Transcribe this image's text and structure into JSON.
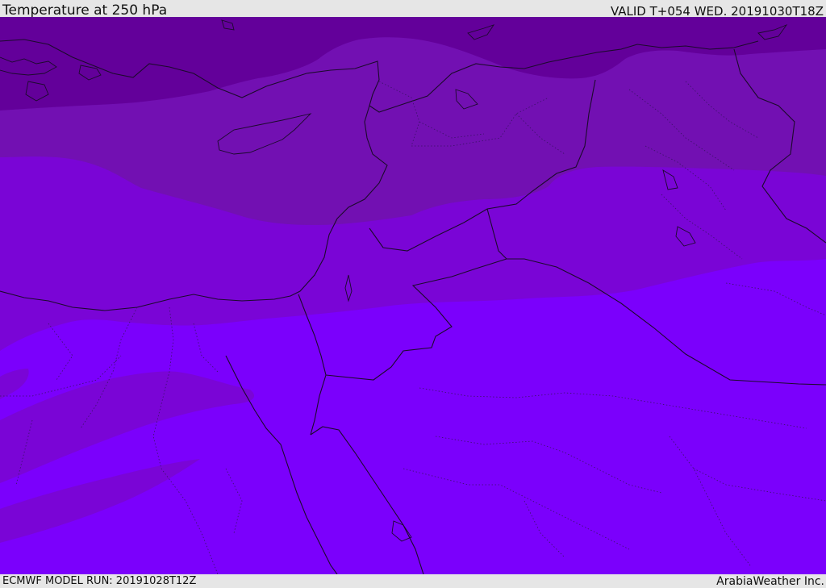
{
  "header": {
    "title": "Temperature at 250 hPa",
    "valid": "VALID T+054 WED. 20191030T18Z"
  },
  "footer": {
    "model_run": "ECMWF MODEL RUN: 20191028T12Z",
    "credit": "ArabiaWeather Inc."
  },
  "map": {
    "colors": {
      "band_coldest": "#63009a",
      "band_cold": "#7210b2",
      "band_mid": "#7a05d6",
      "band_warm": "#7b00fc",
      "border_line": "#1c0a2c",
      "admin_line": "#3a1266"
    }
  }
}
